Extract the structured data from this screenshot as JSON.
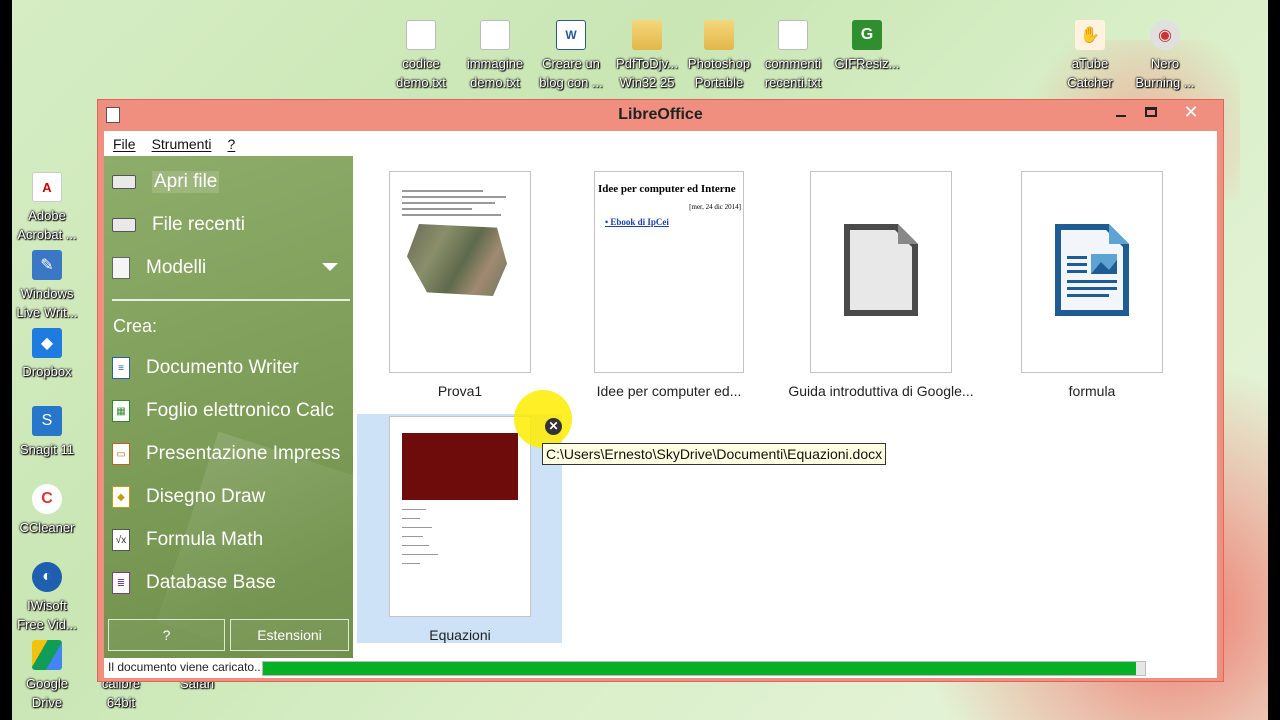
{
  "desktop": {
    "icons_top": [
      {
        "name": "codice-demo-icon",
        "kind": "file",
        "label": "codice\ndemo.txt"
      },
      {
        "name": "immagine-demo-icon",
        "kind": "file",
        "label": "immagine\ndemo.txt"
      },
      {
        "name": "creare-blog-icon",
        "kind": "word",
        "glyph": "W",
        "label": "Creare un\nblog con ..."
      },
      {
        "name": "pdftodjvu-icon",
        "kind": "folder",
        "label": "PdfToDjv...\nWin32 25"
      },
      {
        "name": "photoshop-portable-icon",
        "kind": "folder",
        "label": "Photoshop\nPortable"
      },
      {
        "name": "commenti-recenti-icon",
        "kind": "file",
        "label": "commenti\nrecenti.txt"
      },
      {
        "name": "gifresize-icon",
        "kind": "gif",
        "glyph": "G",
        "label": "GIFResiz..."
      },
      {
        "name": "atube-catcher-icon",
        "kind": "atube",
        "glyph": "✋",
        "label": "aTube\nCatcher"
      },
      {
        "name": "nero-burning-icon",
        "kind": "nero",
        "glyph": "◉",
        "label": "Nero\nBurning ..."
      }
    ],
    "icons_left": [
      {
        "name": "adobe-acrobat-icon",
        "kind": "pdf",
        "glyph": "A",
        "label": "Adobe\nAcrobat ..."
      },
      {
        "name": "windows-live-writer-icon",
        "kind": "wlw",
        "glyph": "✎",
        "label": "Windows\nLive Writ..."
      },
      {
        "name": "dropbox-icon",
        "kind": "drop",
        "glyph": "◆",
        "label": "Dropbox"
      },
      {
        "name": "snagit-icon",
        "kind": "snag",
        "glyph": "S",
        "label": "Snagit 11"
      },
      {
        "name": "ccleaner-icon",
        "kind": "ccl",
        "glyph": "C",
        "label": "CCleaner"
      },
      {
        "name": "iwisoft-icon",
        "kind": "iws",
        "glyph": "◐",
        "label": "IWisoft\nFree Vid..."
      },
      {
        "name": "google-drive-icon",
        "kind": "gdrive",
        "glyph": "",
        "label": "Google\nDrive"
      }
    ],
    "icons_partial": [
      {
        "name": "calibre-icon",
        "label": "calibre\n64bit"
      },
      {
        "name": "safari-icon",
        "label": "Safari"
      }
    ]
  },
  "window": {
    "title": "LibreOffice",
    "close_glyph": "✕"
  },
  "menu": {
    "file": "File",
    "strumenti": "Strumenti",
    "help": "?"
  },
  "sidebar": {
    "open_file": "Apri file",
    "recent_files": "File recenti",
    "templates": "Modelli",
    "create_label": "Crea:",
    "create_items": [
      {
        "name": "create-writer",
        "icon": "writer",
        "glyph": "≡",
        "label": "Documento Writer"
      },
      {
        "name": "create-calc",
        "icon": "calc",
        "glyph": "▦",
        "label": "Foglio elettronico Calc"
      },
      {
        "name": "create-impress",
        "icon": "impress",
        "glyph": "▭",
        "label": "Presentazione Impress"
      },
      {
        "name": "create-draw",
        "icon": "draw",
        "glyph": "◆",
        "label": "Disegno Draw"
      },
      {
        "name": "create-math",
        "icon": "math",
        "glyph": "√x",
        "label": "Formula Math"
      },
      {
        "name": "create-base",
        "icon": "base",
        "glyph": "≣",
        "label": "Database Base"
      }
    ],
    "help_button": "?",
    "extensions_button": "Estensioni"
  },
  "recent_documents": [
    {
      "name": "recent-doc-prova1",
      "label": "Prova1",
      "preview": "photo-doc"
    },
    {
      "name": "recent-doc-idee",
      "label": "Idee per computer ed...",
      "preview": "text-doc",
      "preview_title": "Idee per computer ed Interne",
      "preview_date": "[mer, 24 dic 2014]",
      "preview_link": "Ebook di IpCei"
    },
    {
      "name": "recent-doc-guida",
      "label": "Guida introduttiva di Google...",
      "preview": "draw-icon"
    },
    {
      "name": "recent-doc-formula",
      "label": "formula",
      "preview": "writer-icon"
    },
    {
      "name": "recent-doc-equazioni",
      "label": "Equazioni",
      "preview": "equation-doc",
      "selected": true
    }
  ],
  "tooltip": {
    "text": "C:\\Users\\Ernesto\\SkyDrive\\Documenti\\Equazioni.docx"
  },
  "remove_glyph": "✕",
  "status": {
    "text": "Il documento viene caricato...",
    "progress": 0.99,
    "progress_color": "#06b025"
  },
  "colors": {
    "window_frame": "#f08f7f",
    "sidebar_green": "#7a9a55",
    "selection": "#cde2f6"
  }
}
